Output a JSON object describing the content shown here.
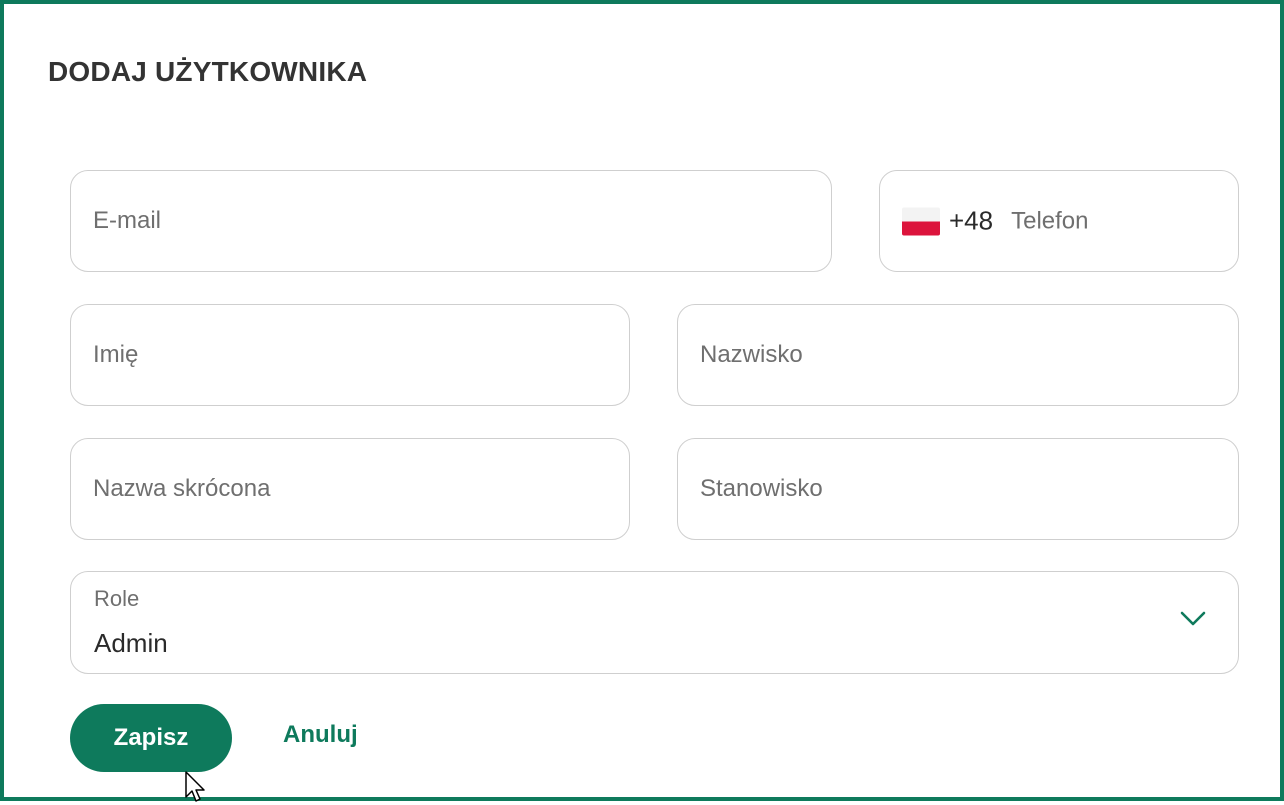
{
  "dialog": {
    "title": "DODAJ UŻYTKOWNIKA"
  },
  "form": {
    "email": {
      "placeholder": "E-mail",
      "value": ""
    },
    "phone": {
      "country_flag": "poland-flag-icon",
      "dial_code": "+48",
      "placeholder": "Telefon",
      "value": ""
    },
    "first_name": {
      "placeholder": "Imię",
      "value": ""
    },
    "last_name": {
      "placeholder": "Nazwisko",
      "value": ""
    },
    "short_name": {
      "placeholder": "Nazwa skrócona",
      "value": ""
    },
    "position": {
      "placeholder": "Stanowisko",
      "value": ""
    },
    "role": {
      "label": "Role",
      "value": "Admin",
      "icon": "chevron-down-icon"
    }
  },
  "actions": {
    "save_label": "Zapisz",
    "cancel_label": "Anuluj"
  },
  "colors": {
    "accent": "#0e7a5c",
    "border": "#cfcfcf",
    "title": "#333333",
    "placeholder": "#6f6f6f"
  }
}
